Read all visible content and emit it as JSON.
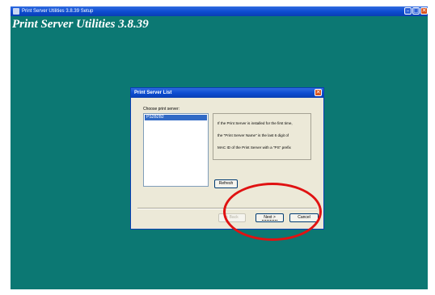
{
  "window": {
    "title": "Print Server Utilities 3.8.39 Setup",
    "banner": "Print Server Utilities 3.8.39",
    "minimize_glyph": "–",
    "maximize_glyph": "□",
    "close_glyph": "✕"
  },
  "dialog": {
    "title": "Print Server List",
    "close_glyph": "✕",
    "choose_label": "Choose print server:",
    "servers": [
      "PS2B2B2"
    ],
    "info_lines": [
      "If the Print Server is installed for the first time,",
      "the \"Print Server Name\" is the last 6 digit of",
      "MAC ID of the Print Server with a \"PS\" prefix"
    ],
    "refresh_label": "Refresh",
    "back_label": "< Back",
    "next_label": "Next >",
    "cancel_label": "Cancel"
  },
  "colors": {
    "desktop": "#0c7873",
    "title_blue": "#0c4bd0",
    "highlight": "#e01212"
  },
  "icons": {
    "app": "setup-app-icon",
    "minimize": "minimize-icon",
    "maximize": "maximize-icon",
    "close": "close-icon"
  }
}
